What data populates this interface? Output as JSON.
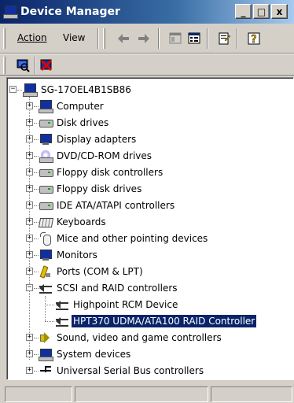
{
  "window": {
    "title": "Device Manager"
  },
  "title_buttons": {
    "minimize": "_",
    "maximize": "□",
    "close": "x"
  },
  "menu": {
    "action": "Action",
    "view": "View"
  },
  "toolbar": {
    "back_icon": "back-arrow-icon",
    "forward_icon": "forward-arrow-icon",
    "icons": [
      "show-hide-console-tree-icon",
      "properties-list-icon",
      "properties-icon",
      "help-icon"
    ],
    "second_row_icons": [
      "scan-hardware-icon",
      "uninstall-icon"
    ]
  },
  "tree": {
    "root": "SG-17OEL4B1SB86",
    "categories": [
      {
        "label": "Computer",
        "icon": "computer-icon"
      },
      {
        "label": "Disk drives",
        "icon": "disk-drive-icon"
      },
      {
        "label": "Display adapters",
        "icon": "display-adapter-icon"
      },
      {
        "label": "DVD/CD-ROM drives",
        "icon": "cdrom-icon"
      },
      {
        "label": "Floppy disk controllers",
        "icon": "floppy-controller-icon"
      },
      {
        "label": "Floppy disk drives",
        "icon": "floppy-drive-icon"
      },
      {
        "label": "IDE ATA/ATAPI controllers",
        "icon": "ide-controller-icon"
      },
      {
        "label": "Keyboards",
        "icon": "keyboard-icon"
      },
      {
        "label": "Mice and other pointing devices",
        "icon": "mouse-icon"
      },
      {
        "label": "Monitors",
        "icon": "monitor-icon"
      },
      {
        "label": "Ports (COM & LPT)",
        "icon": "ports-icon"
      },
      {
        "label": "SCSI and RAID controllers",
        "icon": "scsi-controller-icon",
        "expanded": true,
        "children": [
          {
            "label": "Highpoint RCM Device",
            "icon": "scsi-device-icon"
          },
          {
            "label": "HPT370 UDMA/ATA100 RAID Controller",
            "icon": "scsi-device-icon",
            "selected": true
          }
        ]
      },
      {
        "label": "Sound, video and game controllers",
        "icon": "sound-icon"
      },
      {
        "label": "System devices",
        "icon": "system-devices-icon"
      },
      {
        "label": "Universal Serial Bus controllers",
        "icon": "usb-icon"
      }
    ]
  },
  "colors": {
    "selection": "#0a246a",
    "titlebar": "#0a246a",
    "face": "#d4d0c8"
  }
}
